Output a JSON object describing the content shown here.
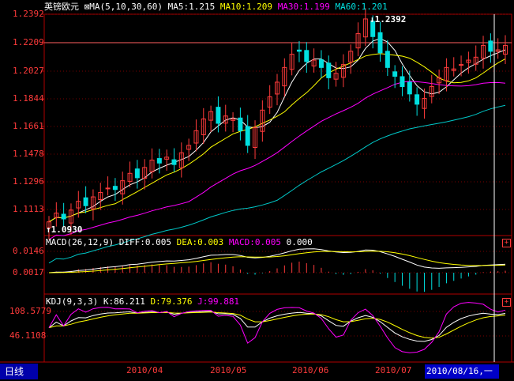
{
  "main": {
    "symbol": "英镑欧元",
    "ma_label": "MA(5,10,30,60)",
    "ma5": "MA5:1.215",
    "ma10": "MA10:1.209",
    "ma30": "MA30:1.199",
    "ma60": "MA60:1.201",
    "peak_label": "1.2392",
    "low_label": "1.0930",
    "y_ticks": [
      "1.2392",
      "1.2209",
      "1.2027",
      "1.1844",
      "1.1661",
      "1.1478",
      "1.1296",
      "1.1113"
    ]
  },
  "macd": {
    "label": "MACD(26,12,9)",
    "diff": "DIFF:0.005",
    "dea": "DEA:0.003",
    "macd": "MACD:0.005",
    "zero": "0.000",
    "y_ticks": [
      "0.0146",
      "0.0017"
    ]
  },
  "kdj": {
    "label": "KDJ(9,3,3)",
    "k": "K:86.211",
    "d": "D:79.376",
    "j": "J:99.881",
    "y_ticks": [
      "108.5779",
      "46.1108"
    ]
  },
  "x_ticks": [
    "2010/04",
    "2010/05",
    "2010/06",
    "2010/07"
  ],
  "period_tab": "日线",
  "cursor_date": "2010/08/16,一",
  "colors": {
    "up": "#ff3b3b",
    "down": "#00e0e0",
    "ma5": "#ffffff",
    "ma10": "#ffff00",
    "ma30": "#ff00ff",
    "ma60": "#00c8c8"
  },
  "chart_data": {
    "type": "candlestick",
    "title": "英镑欧元",
    "ylim": [
      1.093,
      1.2392
    ],
    "x_ticks": [
      "2010/04",
      "2010/05",
      "2010/06",
      "2010/07"
    ],
    "close_series_approx": [
      1.098,
      1.104,
      1.1,
      1.106,
      1.112,
      1.109,
      1.115,
      1.118,
      1.121,
      1.12,
      1.126,
      1.131,
      1.128,
      1.135,
      1.14,
      1.138,
      1.142,
      1.137,
      1.145,
      1.15,
      1.16,
      1.168,
      1.173,
      1.165,
      1.17,
      1.168,
      1.16,
      1.15,
      1.162,
      1.174,
      1.183,
      1.193,
      1.203,
      1.212,
      1.214,
      1.207,
      1.208,
      1.203,
      1.196,
      1.199,
      1.205,
      1.214,
      1.226,
      1.236,
      1.224,
      1.213,
      1.203,
      1.197,
      1.19,
      1.185,
      1.178,
      1.182,
      1.19,
      1.196,
      1.203,
      1.202,
      1.205,
      1.208,
      1.21,
      1.218,
      1.214,
      1.215,
      1.218
    ],
    "ma_current": {
      "MA5": 1.215,
      "MA10": 1.209,
      "MA30": 1.199,
      "MA60": 1.201
    },
    "macd_current": {
      "DIFF": 0.005,
      "DEA": 0.003,
      "MACD": 0.005
    },
    "kdj_current": {
      "K": 86.211,
      "D": 79.376,
      "J": 99.881
    }
  }
}
